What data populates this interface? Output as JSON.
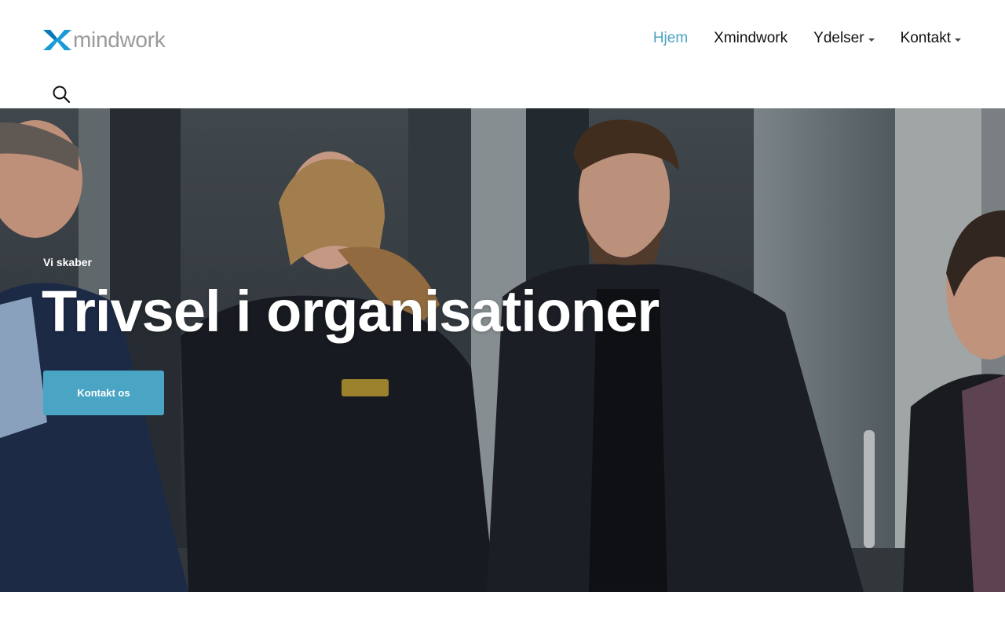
{
  "brand": {
    "logo_text": "mindwork",
    "logo_icon": "x-mark-logo-icon",
    "accent_color": "#49a3c2"
  },
  "nav": {
    "items": [
      {
        "label": "Hjem",
        "active": true
      },
      {
        "label": "Xmindwork",
        "active": false
      },
      {
        "label": "Ydelser",
        "active": false,
        "dropdown": true
      },
      {
        "label": "Kontakt",
        "active": false,
        "dropdown": true
      }
    ],
    "search_icon": "search-icon"
  },
  "hero": {
    "subtitle": "Vi skaber",
    "title": "Trivsel i organisationer",
    "cta_label": "Kontakt os",
    "cta_color": "#4aa5c5"
  }
}
